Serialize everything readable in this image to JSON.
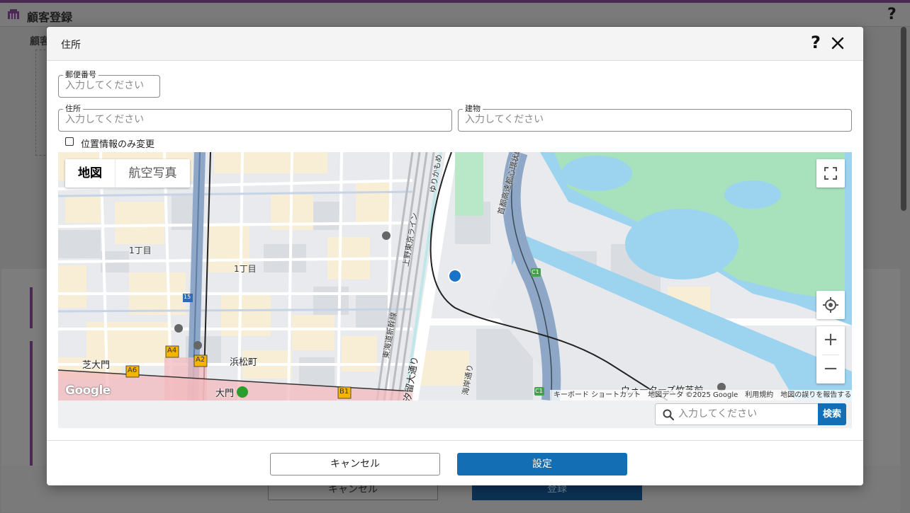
{
  "background": {
    "app_title": "顧客登録",
    "help_label": "?",
    "section_label": "顧客",
    "cancel_label": "キャンセル",
    "register_label": "登録"
  },
  "dialog": {
    "title": "住所",
    "help_label": "?",
    "postal": {
      "label": "郵便番号",
      "placeholder": "入力してください",
      "value": ""
    },
    "address": {
      "label": "住所",
      "placeholder": "入力してください",
      "value": ""
    },
    "building": {
      "label": "建物",
      "placeholder": "入力してください",
      "value": ""
    },
    "location_only": {
      "label": "位置情報のみ変更",
      "checked": false
    },
    "map": {
      "type_map": "地図",
      "type_satellite": "航空写真",
      "attribution": {
        "shortcuts": "キーボード ショートカット",
        "data": "地図データ ©2025 Google",
        "terms": "利用規約",
        "report": "地図の誤りを報告する"
      },
      "google_logo": "Google",
      "labels": {
        "chome1a": "1丁目",
        "chome1b": "1丁目",
        "shiba_daimon": "芝大門",
        "hamamatsucho": "浜松町",
        "daimon": "大門",
        "waters": "ウォーターズ竹芝前",
        "yurikamome": "ゆりかもめ",
        "ueno_tokyo": "上野東京ライン",
        "tokaido": "東海道新幹線",
        "shiodome": "汐留大通り",
        "shuto": "首都高速都心環状線",
        "kaigan": "海岸通り",
        "route15": "15",
        "c1": "C1",
        "c1b": "C1",
        "a4": "A4",
        "a6": "A6",
        "a2": "A2",
        "b1": "B1"
      },
      "zoom_in": "+",
      "zoom_out": "−"
    },
    "search": {
      "placeholder": "入力してください",
      "button": "検索"
    },
    "cancel_label": "キャンセル",
    "ok_label": "設定"
  },
  "colors": {
    "primary": "#146eb4",
    "brand": "#4a2a55",
    "water": "#9cd3ef",
    "park": "#a8e2bd",
    "highway": "#8ea7c6",
    "marker": "#1a73c8"
  }
}
